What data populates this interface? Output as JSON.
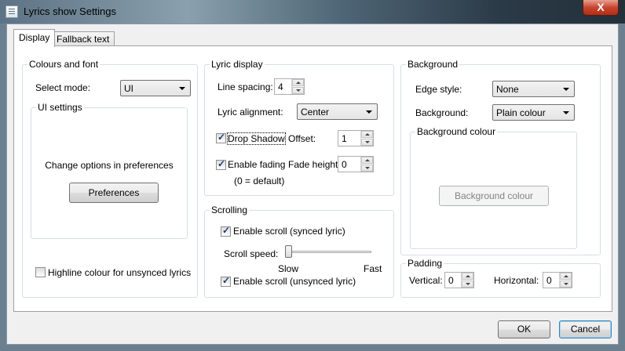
{
  "window": {
    "title": "Lyrics show Settings",
    "close_glyph": "X"
  },
  "tabs": [
    {
      "label": "Display",
      "active": true
    },
    {
      "label": "Fallback text",
      "active": false
    }
  ],
  "colours_font": {
    "title": "Colours and font",
    "select_mode_label": "Select mode:",
    "select_mode_value": "UI",
    "ui_settings": {
      "title": "UI settings",
      "info": "Change options in preferences",
      "preferences_button": "Preferences"
    },
    "highline_label": "Highline colour for unsynced lyrics",
    "highline_checked": false
  },
  "lyric_display": {
    "title": "Lyric display",
    "line_spacing_label": "Line spacing:",
    "line_spacing_value": "4",
    "alignment_label": "Lyric alignment:",
    "alignment_value": "Center",
    "drop_shadow_label": "Drop Shadow",
    "drop_shadow_checked": true,
    "offset_label": "Offset:",
    "offset_value": "1",
    "enable_fading_label": "Enable fading",
    "enable_fading_checked": true,
    "fade_height_label": "Fade height:",
    "fade_height_value": "0",
    "default_note": "(0 = default)"
  },
  "scrolling": {
    "title": "Scrolling",
    "enable_synced_label": "Enable scroll (synced lyric)",
    "enable_synced_checked": true,
    "speed_label": "Scroll speed:",
    "speed_fraction": 0.0,
    "slow_label": "Slow",
    "fast_label": "Fast",
    "enable_unsynced_label": "Enable scroll (unsynced lyric)",
    "enable_unsynced_checked": true
  },
  "background": {
    "title": "Background",
    "edge_style_label": "Edge style:",
    "edge_style_value": "None",
    "background_label": "Background:",
    "background_value": "Plain colour",
    "colour_group_title": "Background colour",
    "colour_button": "Background colour"
  },
  "padding": {
    "title": "Padding",
    "vertical_label": "Vertical:",
    "vertical_value": "0",
    "horizontal_label": "Horizontal:",
    "horizontal_value": "0"
  },
  "footer": {
    "ok_label": "OK",
    "cancel_label": "Cancel"
  }
}
